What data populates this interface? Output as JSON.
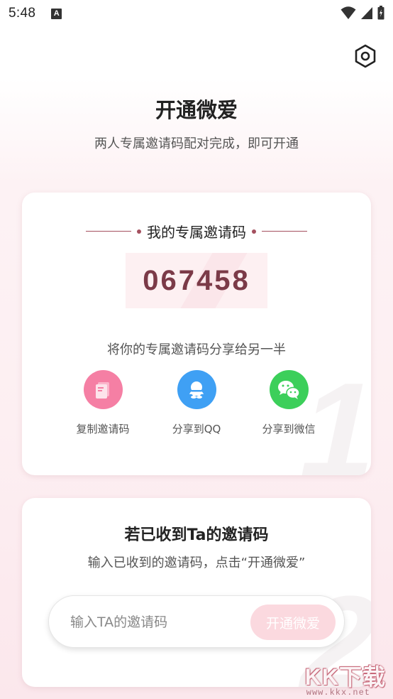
{
  "status_bar": {
    "time": "5:48",
    "app_icon_letter": "A"
  },
  "header": {
    "title": "开通微爱",
    "subtitle": "两人专属邀请码配对完成，即可开通"
  },
  "my_code_card": {
    "heading": "我的专属邀请码",
    "code": "067458",
    "share_tip": "将你的专属邀请码分享给另一半",
    "share_options": [
      {
        "label": "复制邀请码",
        "icon": "copy-icon",
        "color": "#f57fa4"
      },
      {
        "label": "分享到QQ",
        "icon": "qq-icon",
        "color": "#3fa0f4"
      },
      {
        "label": "分享到微信",
        "icon": "wechat-icon",
        "color": "#3ccf5a"
      }
    ],
    "watermark": "1"
  },
  "enter_code_card": {
    "title": "若已收到Ta的邀请码",
    "description": "输入已收到的邀请码，点击“开通微爱”",
    "input_placeholder": "输入TA的邀请码",
    "input_value": "",
    "button_label": "开通微爱",
    "watermark": "2"
  },
  "site_logo": {
    "text": "KK下载",
    "url": "www.kkx.net"
  },
  "colors": {
    "accent": "#7b3a48",
    "button_bg": "#fbd9df",
    "divider": "#a4505f"
  }
}
